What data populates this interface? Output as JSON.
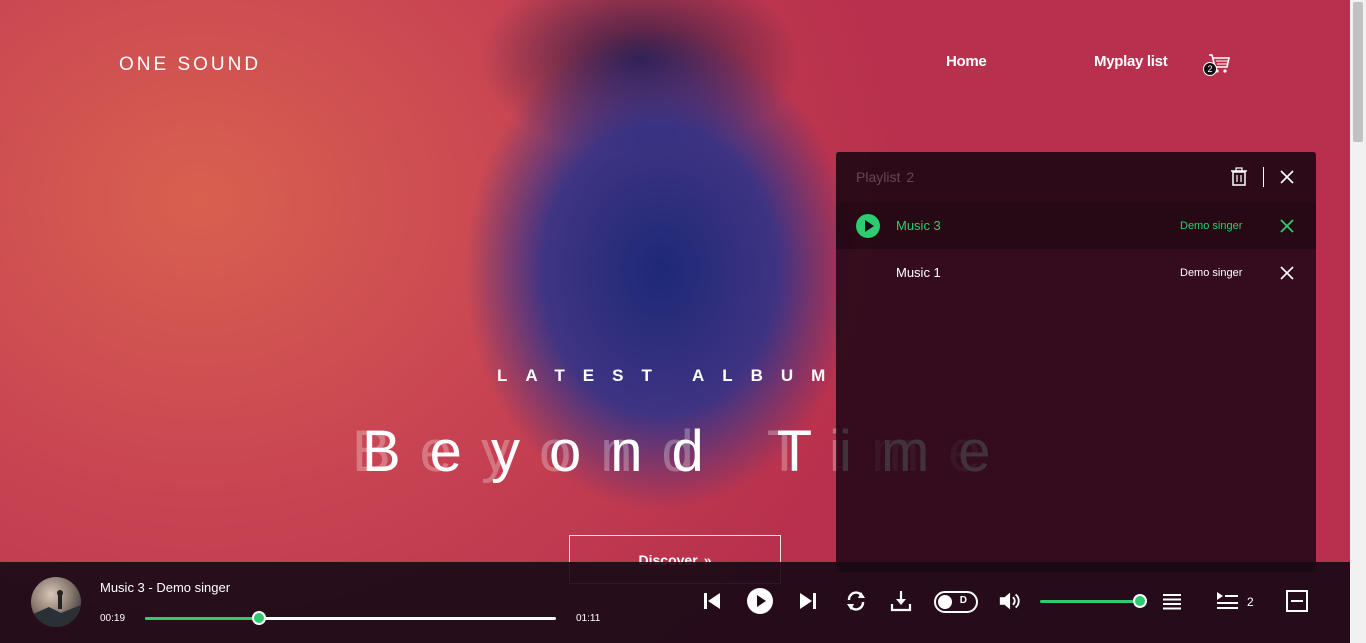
{
  "header": {
    "brand": "ONE SOUND",
    "nav": [
      {
        "label": "Home"
      },
      {
        "label": "Myplay list"
      }
    ],
    "cart_count": "2"
  },
  "hero": {
    "kicker": "LATEST ALBUM",
    "title": "Beyond Time",
    "title_shadow": "Beyond Time",
    "cta_label": "Discover",
    "cta_icon": "double-chevron-right-icon"
  },
  "playlist": {
    "title": "Playlist",
    "count": "2",
    "items": [
      {
        "name": "Music 3",
        "artist": "Demo singer",
        "active": true
      },
      {
        "name": "Music 1",
        "artist": "Demo singer",
        "active": false
      }
    ]
  },
  "player": {
    "now_playing": "Music 3 - Demo singer",
    "current_time": "00:19",
    "total_time": "01:11",
    "progress": 0.277,
    "volume": 1.0,
    "toggle_label": "D",
    "queue_count": "2"
  },
  "colors": {
    "accent": "#2ecc71",
    "player_bg": "#190a16",
    "panel_bg": "#19051a"
  }
}
